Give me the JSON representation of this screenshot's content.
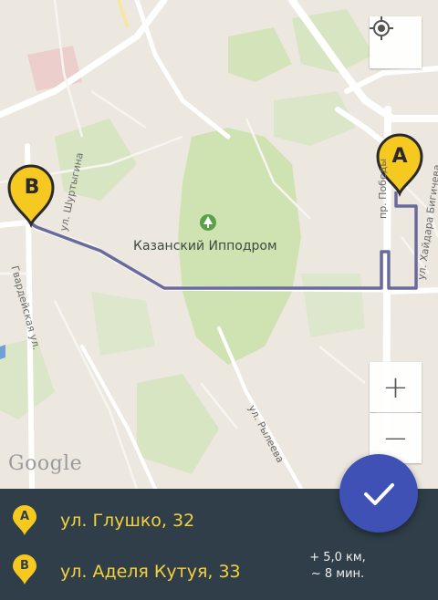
{
  "map": {
    "poi_label": "Казанский Ипподром",
    "streets": [
      "ул. Шуртыгина",
      "пр. Победы",
      "ул. Хайдара Бигичева",
      "Гвардейская ул.",
      "ул. Рылеева"
    ],
    "logo": "Google",
    "markers": [
      {
        "id": "A",
        "label": "A",
        "color": "#f6c921"
      },
      {
        "id": "B",
        "label": "B",
        "color": "#f6c921"
      }
    ]
  },
  "controls": {
    "locate_icon": "my-location-icon",
    "zoom_in": "+",
    "zoom_out": "−",
    "confirm_icon": "checkmark-icon"
  },
  "route": {
    "from_label": "A",
    "from_address": "ул. Глушко, 32",
    "to_label": "B",
    "to_address": "ул. Аделя Кутуя, 33",
    "distance": "+ 5,0 км,",
    "duration": "~ 8 мин."
  },
  "colors": {
    "panel_bg": "#2f3e48",
    "accent_yellow": "#f6c921",
    "fab_blue": "#3f51b5",
    "route_line": "#6b6a9c"
  }
}
